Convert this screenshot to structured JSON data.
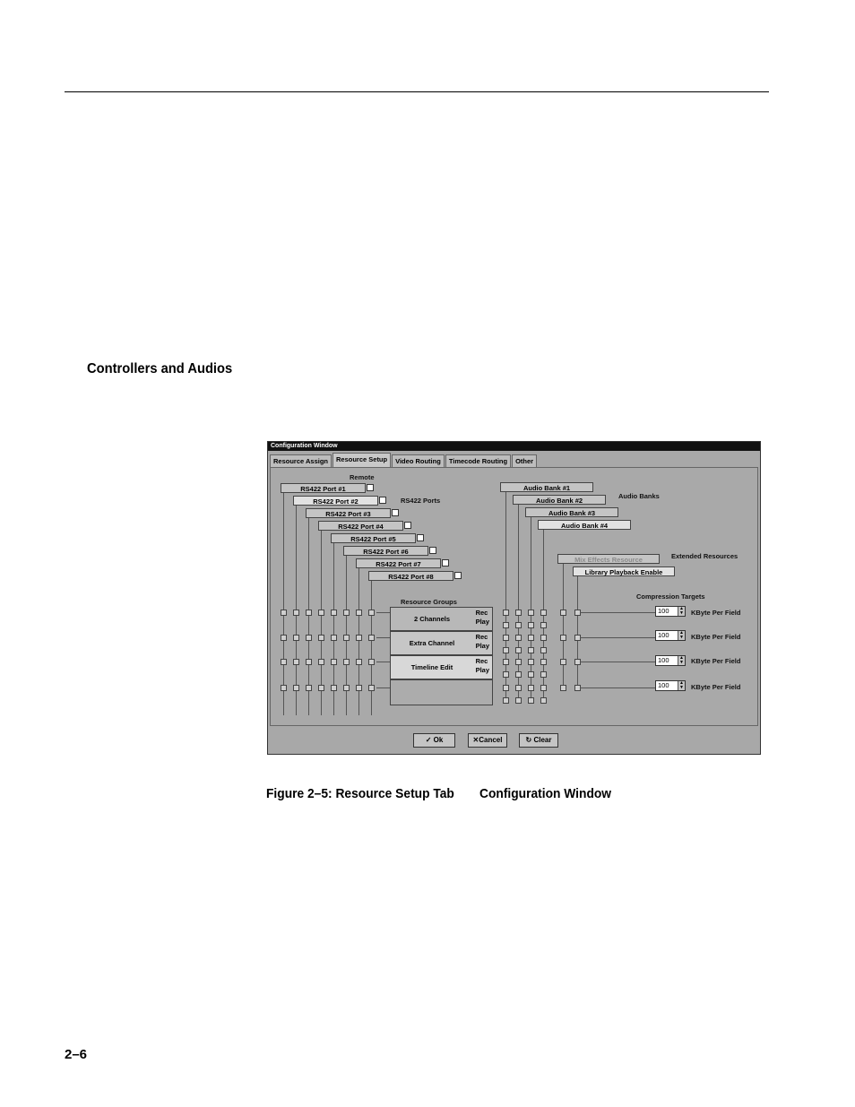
{
  "page": {
    "heading": "Controllers and Audios",
    "caption_left": "Figure 2–5: Resource Setup Tab",
    "caption_right": "Configuration Window",
    "page_number": "2–6"
  },
  "window": {
    "title": "Configuration Window",
    "tabs": [
      "Resource Assign",
      "Resource Setup",
      "Video Routing",
      "Timecode Routing",
      "Other"
    ],
    "active_tab": "Resource Setup",
    "remote_label": "Remote",
    "rs422_ports_label": "RS422 Ports",
    "rs422_ports": [
      "RS422 Port #1",
      "RS422 Port #2",
      "RS422 Port #3",
      "RS422 Port #4",
      "RS422 Port #5",
      "RS422 Port #6",
      "RS422 Port #7",
      "RS422 Port #8"
    ],
    "audio_banks_label": "Audio Banks",
    "audio_banks": [
      "Audio Bank #1",
      "Audio Bank #2",
      "Audio Bank #3",
      "Audio Bank #4"
    ],
    "extended_resources_label": "Extended Resources",
    "extended_resources": [
      "Mix Effects Resource",
      "Library Playback Enable"
    ],
    "resource_groups_label": "Resource Groups",
    "resource_groups": [
      {
        "name": "2 Channels",
        "rec": "Rec",
        "play": "Play"
      },
      {
        "name": "Extra Channel",
        "rec": "Rec",
        "play": "Play"
      },
      {
        "name": "Timeline Edit",
        "rec": "Rec",
        "play": "Play"
      }
    ],
    "compression_targets_label": "Compression Targets",
    "compression_targets": [
      {
        "value": "100",
        "unit": "KByte Per Field"
      },
      {
        "value": "100",
        "unit": "KByte Per Field"
      },
      {
        "value": "100",
        "unit": "KByte Per Field"
      },
      {
        "value": "100",
        "unit": "KByte Per Field"
      }
    ],
    "buttons": {
      "ok": "Ok",
      "cancel": "Cancel",
      "clear": "Clear"
    }
  }
}
